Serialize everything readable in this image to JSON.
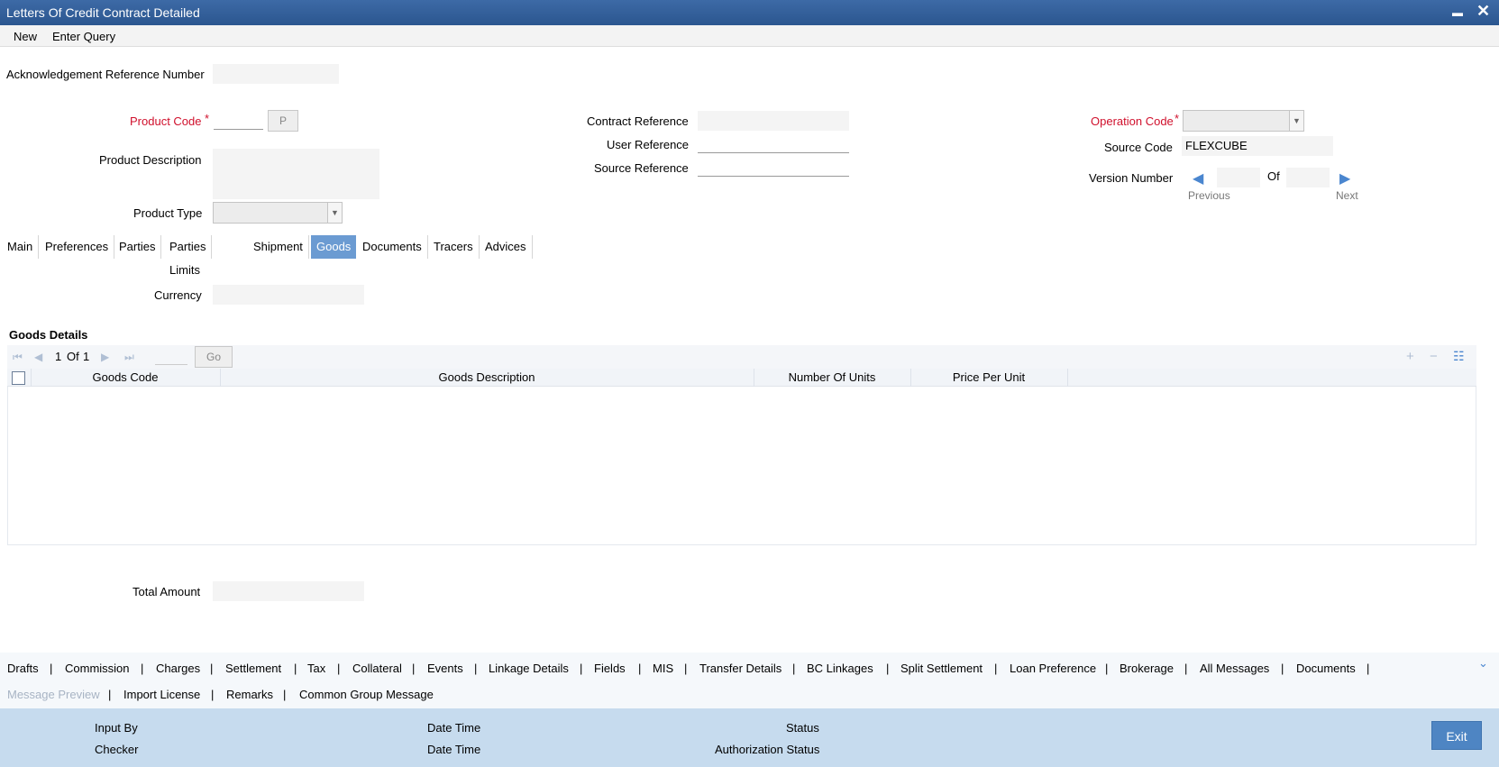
{
  "window": {
    "title": "Letters Of Credit Contract Detailed",
    "minimize_glyph": "▬",
    "close_glyph": "✕"
  },
  "menu": {
    "new": "New",
    "enter_query": "Enter Query"
  },
  "header": {
    "ack_ref_label": "Acknowledgement Reference Number",
    "ack_ref_value": "",
    "product_code_label": "Product Code",
    "product_code_value": "",
    "product_code_button": "P",
    "product_desc_label": "Product Description",
    "product_desc_value": "",
    "product_type_label": "Product Type",
    "product_type_value": "",
    "contract_ref_label": "Contract Reference",
    "contract_ref_value": "",
    "user_ref_label": "User Reference",
    "user_ref_value": "",
    "source_ref_label": "Source Reference",
    "source_ref_value": "",
    "operation_code_label": "Operation Code",
    "operation_code_value": "",
    "source_code_label": "Source Code",
    "source_code_value": "FLEXCUBE",
    "version_label": "Version Number",
    "version_of": "Of",
    "version_current": "",
    "version_total": "",
    "previous": "Previous",
    "next": "Next",
    "required_mark": "*"
  },
  "tabs": [
    {
      "label": "Main",
      "active": false
    },
    {
      "label": "Preferences",
      "active": false
    },
    {
      "label": "Parties",
      "active": false
    },
    {
      "label": "Parties Limits",
      "active": false
    },
    {
      "label": "Shipment",
      "active": false
    },
    {
      "label": "Goods",
      "active": true
    },
    {
      "label": "Documents",
      "active": false
    },
    {
      "label": "Tracers",
      "active": false
    },
    {
      "label": "Advices",
      "active": false
    }
  ],
  "goods_tab": {
    "currency_label": "Currency",
    "currency_value": "",
    "section_title": "Goods Details",
    "pager": {
      "current": "1",
      "of": "Of",
      "total": "1",
      "go": "Go",
      "page_input": ""
    },
    "columns": [
      "Goods Code",
      "Goods Description",
      "Number Of Units",
      "Price Per Unit"
    ],
    "rows": [],
    "total_amount_label": "Total Amount",
    "total_amount_value": ""
  },
  "bottom_links": {
    "row1": [
      "Drafts",
      "Commission",
      "Charges",
      "Settlement",
      "Tax",
      "Collateral",
      "Events",
      "Linkage Details",
      "Fields",
      "MIS",
      "Transfer Details",
      "BC Linkages",
      "Split Settlement",
      "Loan Preference",
      "Brokerage",
      "All Messages",
      "Documents"
    ],
    "row2": [
      "Message Preview",
      "Import License",
      "Remarks",
      "Common Group Message"
    ],
    "separator": "|"
  },
  "footer": {
    "input_by": "Input By",
    "checker": "Checker",
    "date_time_1": "Date Time",
    "date_time_2": "Date Time",
    "status": "Status",
    "auth_status": "Authorization Status",
    "exit": "Exit"
  },
  "colors": {
    "title_bar": "#2b568f",
    "active_tab": "#6b9bd2",
    "required": "#d0102c",
    "footer": "#c6dbee",
    "exit_button": "#4e85c3"
  }
}
